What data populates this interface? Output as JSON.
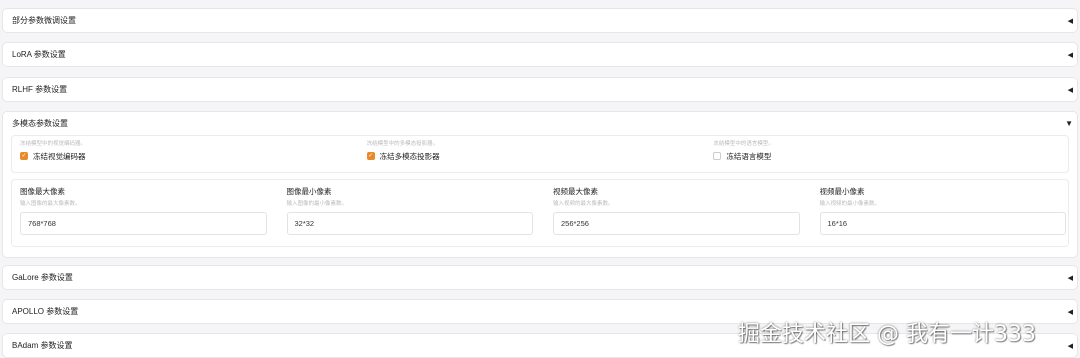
{
  "sections": {
    "partial_finetune": {
      "title": "部分参数微调设置",
      "arrow": "◀"
    },
    "lora": {
      "title": "LoRA 参数设置",
      "arrow": "◀"
    },
    "rlhf": {
      "title": "RLHF 参数设置",
      "arrow": "◀"
    },
    "multimodal": {
      "title": "多模态参数设置",
      "arrow": "▼",
      "freeze": [
        {
          "info": "冻结模型中的视觉编码器。",
          "label": "冻结视觉编码器",
          "checked": true
        },
        {
          "info": "冻结模型中的多模态投影器。",
          "label": "冻结多模态投影器",
          "checked": true
        },
        {
          "info": "冻结模型中的语言模型。",
          "label": "冻结语言模型",
          "checked": false
        }
      ],
      "pixels": [
        {
          "label": "图像最大像素",
          "info": "输入图像的最大像素数。",
          "value": "768*768"
        },
        {
          "label": "图像最小像素",
          "info": "输入图像的最小像素数。",
          "value": "32*32"
        },
        {
          "label": "视频最大像素",
          "info": "输入视频的最大像素数。",
          "value": "256*256"
        },
        {
          "label": "视频最小像素",
          "info": "输入视频的最小像素数。",
          "value": "16*16"
        }
      ]
    },
    "galore": {
      "title": "GaLore 参数设置",
      "arrow": "◀"
    },
    "apollo": {
      "title": "APOLLO 参数设置",
      "arrow": "◀"
    },
    "badam": {
      "title": "BAdam 参数设置",
      "arrow": "◀"
    }
  },
  "checkmark": "✓",
  "watermark": "掘金技术社区 @ 我有一计333",
  "colors": {
    "accent": "#e8892b",
    "border": "#e6e6e6",
    "background": "#f5f5f7"
  }
}
